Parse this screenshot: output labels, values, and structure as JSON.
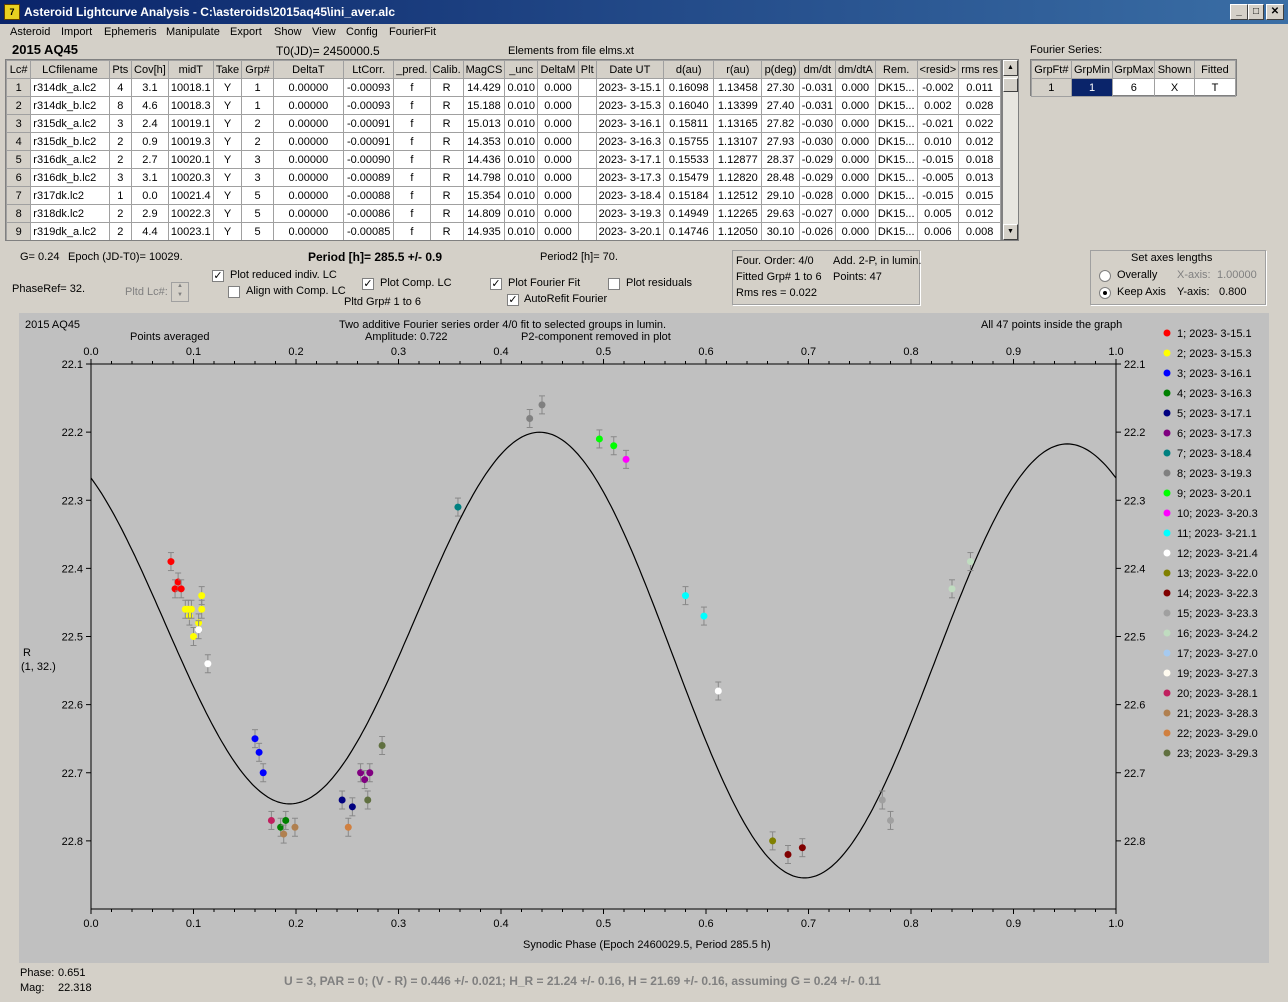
{
  "window": {
    "title": "Asteroid Lightcurve Analysis - C:\\asteroids\\2015aq45\\ini_aver.alc",
    "icon": "7"
  },
  "menu": [
    "Asteroid",
    "Import",
    "Ephemeris",
    "Manipulate",
    "Export",
    "Show",
    "View",
    "Config",
    "FourierFit"
  ],
  "header": {
    "object": "2015 AQ45",
    "t0": "T0(JD)= 2450000.5",
    "elements": "Elements from file elms.xt"
  },
  "table": {
    "columns": [
      "Lc#",
      "LCfilename",
      "Pts",
      "Cov[h]",
      "midT",
      "Take",
      "Grp#",
      "DeltaT",
      "LtCorr.",
      "_pred.",
      "Calib.",
      "MagCS",
      "_unc",
      "DeltaM",
      "Plt",
      "Date UT",
      "d(au)",
      "r(au)",
      "p(deg)",
      "dm/dt",
      "dm/dtA",
      "Rem.",
      "<resid>",
      "rms res"
    ],
    "rows": [
      [
        "1",
        "r314dk_a.lc2",
        "4",
        "3.1",
        "10018.1",
        "Y",
        "1",
        "0.00000",
        "-0.00093",
        "f",
        "R",
        "14.429",
        "0.010",
        "0.000",
        "",
        "2023- 3-15.1",
        "0.16098",
        "1.13458",
        "27.30",
        "-0.031",
        "0.000",
        "DK15...",
        "-0.002",
        "0.011"
      ],
      [
        "2",
        "r314dk_b.lc2",
        "8",
        "4.6",
        "10018.3",
        "Y",
        "1",
        "0.00000",
        "-0.00093",
        "f",
        "R",
        "15.188",
        "0.010",
        "0.000",
        "",
        "2023- 3-15.3",
        "0.16040",
        "1.13399",
        "27.40",
        "-0.031",
        "0.000",
        "DK15...",
        "0.002",
        "0.028"
      ],
      [
        "3",
        "r315dk_a.lc2",
        "3",
        "2.4",
        "10019.1",
        "Y",
        "2",
        "0.00000",
        "-0.00091",
        "f",
        "R",
        "15.013",
        "0.010",
        "0.000",
        "",
        "2023- 3-16.1",
        "0.15811",
        "1.13165",
        "27.82",
        "-0.030",
        "0.000",
        "DK15...",
        "-0.021",
        "0.022"
      ],
      [
        "4",
        "r315dk_b.lc2",
        "2",
        "0.9",
        "10019.3",
        "Y",
        "2",
        "0.00000",
        "-0.00091",
        "f",
        "R",
        "14.353",
        "0.010",
        "0.000",
        "",
        "2023- 3-16.3",
        "0.15755",
        "1.13107",
        "27.93",
        "-0.030",
        "0.000",
        "DK15...",
        "0.010",
        "0.012"
      ],
      [
        "5",
        "r316dk_a.lc2",
        "2",
        "2.7",
        "10020.1",
        "Y",
        "3",
        "0.00000",
        "-0.00090",
        "f",
        "R",
        "14.436",
        "0.010",
        "0.000",
        "",
        "2023- 3-17.1",
        "0.15533",
        "1.12877",
        "28.37",
        "-0.029",
        "0.000",
        "DK15...",
        "-0.015",
        "0.018"
      ],
      [
        "6",
        "r316dk_b.lc2",
        "3",
        "3.1",
        "10020.3",
        "Y",
        "3",
        "0.00000",
        "-0.00089",
        "f",
        "R",
        "14.798",
        "0.010",
        "0.000",
        "",
        "2023- 3-17.3",
        "0.15479",
        "1.12820",
        "28.48",
        "-0.029",
        "0.000",
        "DK15...",
        "-0.005",
        "0.013"
      ],
      [
        "7",
        "r317dk.lc2",
        "1",
        "0.0",
        "10021.4",
        "Y",
        "5",
        "0.00000",
        "-0.00088",
        "f",
        "R",
        "15.354",
        "0.010",
        "0.000",
        "",
        "2023- 3-18.4",
        "0.15184",
        "1.12512",
        "29.10",
        "-0.028",
        "0.000",
        "DK15...",
        "-0.015",
        "0.015"
      ],
      [
        "8",
        "r318dk.lc2",
        "2",
        "2.9",
        "10022.3",
        "Y",
        "5",
        "0.00000",
        "-0.00086",
        "f",
        "R",
        "14.809",
        "0.010",
        "0.000",
        "",
        "2023- 3-19.3",
        "0.14949",
        "1.12265",
        "29.63",
        "-0.027",
        "0.000",
        "DK15...",
        "0.005",
        "0.012"
      ],
      [
        "9",
        "r319dk_a.lc2",
        "2",
        "4.4",
        "10023.1",
        "Y",
        "5",
        "0.00000",
        "-0.00085",
        "f",
        "R",
        "14.935",
        "0.010",
        "0.000",
        "",
        "2023- 3-20.1",
        "0.14746",
        "1.12050",
        "30.10",
        "-0.026",
        "0.000",
        "DK15...",
        "0.006",
        "0.008"
      ]
    ]
  },
  "fourier": {
    "label": "Fourier Series:",
    "columns": [
      "GrpFt#",
      "GrpMin",
      "GrpMax",
      "Shown",
      "Fitted"
    ],
    "row": [
      "1",
      "1",
      "6",
      "X",
      "T"
    ]
  },
  "info": {
    "g": "G= 0.24",
    "epoch": "Epoch (JD-T0)= 10029.",
    "period": "Period [h]= 285.5 +/- 0.9",
    "period2": "Period2 [h]= 70.",
    "phaseref": "PhaseRef= 32.",
    "pltd_lc": "Pltd Lc#:"
  },
  "options": {
    "plot_reduced": "Plot reduced indiv. LC",
    "align": "Align with Comp. LC",
    "plot_comp": "Plot Comp. LC",
    "pltd_grp": "Pltd Grp#  1   to   6",
    "plot_fourier": "Plot Fourier Fit",
    "autorefit": "AutoRefit Fourier",
    "plot_residuals": "Plot residuals"
  },
  "fitbox": {
    "order": "Four. Order:  4/0",
    "add": "Add. 2-P, in lumin.",
    "fitted": "Fitted Grp# 1 to 6",
    "points": "Points: 47",
    "rms": "Rms res     = 0.022"
  },
  "axes": {
    "title": "Set axes lengths",
    "overally": "Overally",
    "keep": "Keep Axis",
    "xaxis_label": "X-axis:",
    "xaxis_val": "1.00000",
    "yaxis_label": "Y-axis:",
    "yaxis_val": "0.800"
  },
  "chart_data": {
    "type": "scatter",
    "title": "2015 AQ45",
    "subtitle": "Two additive Fourier series order 4/0 fit to selected groups in lumin.",
    "amplitude": "Amplitude: 0.722",
    "p2note": "P2-component removed in plot",
    "topleft": "Points averaged",
    "topright": "All 47 points inside the graph",
    "xlabel": "Synodic Phase (Epoch 2460029.5, Period 285.5 h)",
    "ylabel": "R",
    "ylabel2": "(1, 32.)",
    "xlim": [
      0,
      1
    ],
    "ylim": [
      22.1,
      22.9
    ],
    "y_inverted": true,
    "xticks": [
      "0.0",
      "0.1",
      "0.2",
      "0.3",
      "0.4",
      "0.5",
      "0.6",
      "0.7",
      "0.8",
      "0.9",
      "1.0"
    ],
    "yticks": [
      "22.1",
      "22.2",
      "22.3",
      "22.4",
      "22.5",
      "22.6",
      "22.7",
      "22.8"
    ],
    "legend_position": "right",
    "series": [
      {
        "name": "1; 2023- 3-15.1",
        "color": "#ff0000",
        "points": [
          [
            0.078,
            22.39
          ],
          [
            0.082,
            22.43
          ],
          [
            0.085,
            22.42
          ],
          [
            0.088,
            22.43
          ]
        ]
      },
      {
        "name": "2; 2023- 3-15.3",
        "color": "#ffff00",
        "points": [
          [
            0.092,
            22.46
          ],
          [
            0.096,
            22.47
          ],
          [
            0.1,
            22.5
          ],
          [
            0.105,
            22.48
          ],
          [
            0.108,
            22.44
          ],
          [
            0.108,
            22.46
          ],
          [
            0.095,
            22.46
          ],
          [
            0.098,
            22.46
          ]
        ]
      },
      {
        "name": "3; 2023- 3-16.1",
        "color": "#0000ff",
        "points": [
          [
            0.16,
            22.65
          ],
          [
            0.164,
            22.67
          ],
          [
            0.168,
            22.7
          ]
        ]
      },
      {
        "name": "4; 2023- 3-16.3",
        "color": "#008000",
        "points": [
          [
            0.185,
            22.78
          ],
          [
            0.19,
            22.77
          ]
        ]
      },
      {
        "name": "5; 2023- 3-17.1",
        "color": "#000080",
        "points": [
          [
            0.245,
            22.74
          ],
          [
            0.255,
            22.75
          ]
        ]
      },
      {
        "name": "6; 2023- 3-17.3",
        "color": "#800080",
        "points": [
          [
            0.263,
            22.7
          ],
          [
            0.267,
            22.71
          ],
          [
            0.272,
            22.7
          ]
        ]
      },
      {
        "name": "7; 2023- 3-18.4",
        "color": "#008080",
        "points": [
          [
            0.358,
            22.31
          ]
        ]
      },
      {
        "name": "8; 2023- 3-19.3",
        "color": "#808080",
        "points": [
          [
            0.428,
            22.18
          ],
          [
            0.44,
            22.16
          ]
        ]
      },
      {
        "name": "9; 2023- 3-20.1",
        "color": "#00ff00",
        "points": [
          [
            0.496,
            22.21
          ],
          [
            0.51,
            22.22
          ]
        ]
      },
      {
        "name": "10; 2023- 3-20.3",
        "color": "#ff00ff",
        "points": [
          [
            0.522,
            22.24
          ]
        ]
      },
      {
        "name": "11; 2023- 3-21.1",
        "color": "#00ffff",
        "points": [
          [
            0.58,
            22.44
          ],
          [
            0.598,
            22.47
          ]
        ]
      },
      {
        "name": "12; 2023- 3-21.4",
        "color": "#ffffff",
        "points": [
          [
            0.105,
            22.49
          ],
          [
            0.114,
            22.54
          ],
          [
            0.612,
            22.58
          ]
        ]
      },
      {
        "name": "13; 2023- 3-22.0",
        "color": "#808000",
        "points": [
          [
            0.665,
            22.8
          ]
        ]
      },
      {
        "name": "14; 2023- 3-22.3",
        "color": "#800000",
        "points": [
          [
            0.68,
            22.82
          ],
          [
            0.694,
            22.81
          ]
        ]
      },
      {
        "name": "15; 2023- 3-23.3",
        "color": "#a0a0a0",
        "points": [
          [
            0.772,
            22.74
          ],
          [
            0.78,
            22.77
          ]
        ]
      },
      {
        "name": "16; 2023- 3-24.2",
        "color": "#c0dcc0",
        "points": [
          [
            0.84,
            22.43
          ],
          [
            0.858,
            22.39
          ]
        ]
      },
      {
        "name": "17; 2023- 3-27.0",
        "color": "#a6caf0",
        "points": []
      },
      {
        "name": "19; 2023- 3-27.3",
        "color": "#fffbf0",
        "points": []
      },
      {
        "name": "20; 2023- 3-28.1",
        "color": "#c0205f",
        "points": [
          [
            0.176,
            22.77
          ]
        ]
      },
      {
        "name": "21; 2023- 3-28.3",
        "color": "#b08050",
        "points": [
          [
            0.188,
            22.79
          ],
          [
            0.199,
            22.78
          ]
        ]
      },
      {
        "name": "22; 2023- 3-29.0",
        "color": "#d08040",
        "points": [
          [
            0.251,
            22.78
          ]
        ]
      },
      {
        "name": "23; 2023- 3-29.3",
        "color": "#607040",
        "points": [
          [
            0.27,
            22.74
          ],
          [
            0.284,
            22.66
          ]
        ]
      }
    ]
  },
  "status": {
    "phase_label": "Phase:",
    "phase": "0.651",
    "mag_label": "Mag:",
    "mag": "22.318",
    "footer": "U = 3, PAR = 0; (V - R) = 0.446 +/- 0.021; H_R = 21.24 +/- 0.16, H = 21.69 +/- 0.16, assuming G = 0.24 +/- 0.11"
  }
}
